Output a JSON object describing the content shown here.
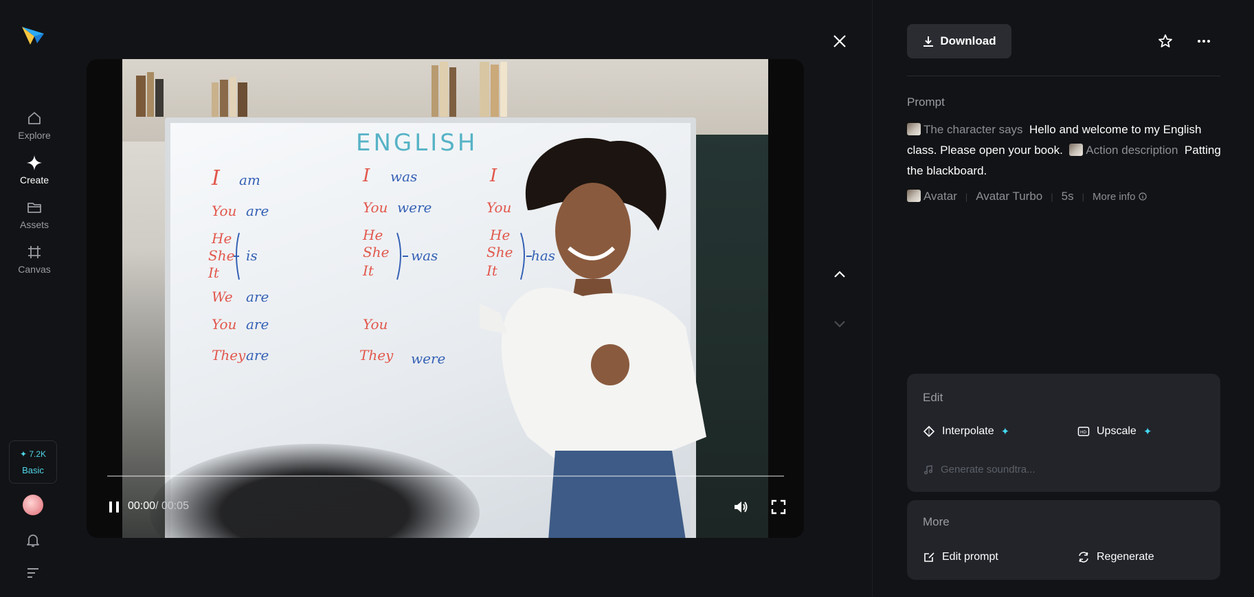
{
  "nav": {
    "items": [
      {
        "label": "Explore",
        "icon": "home-icon",
        "active": false
      },
      {
        "label": "Create",
        "icon": "sparkle-icon",
        "active": true
      },
      {
        "label": "Assets",
        "icon": "folder-icon",
        "active": false
      },
      {
        "label": "Canvas",
        "icon": "canvas-icon",
        "active": false
      }
    ],
    "credits": {
      "amount": "✦ 7.2K",
      "plan": "Basic"
    }
  },
  "player": {
    "current_time": "00:00",
    "total_time": "/ 00:05",
    "progress": 0,
    "board_title": "ENGLISH"
  },
  "toolbar": {
    "download_label": "Download"
  },
  "prompt": {
    "title": "Prompt",
    "chip_says": "The character says",
    "says_text": "Hello and welcome to my English class. Please open your book.",
    "chip_action": "Action description",
    "action_text": "Patting the blackboard."
  },
  "meta": {
    "type": "Avatar",
    "model": "Avatar Turbo",
    "duration": "5s",
    "more_info": "More info"
  },
  "edit": {
    "title": "Edit",
    "interpolate": "Interpolate",
    "upscale": "Upscale",
    "soundtrack": "Generate soundtra..."
  },
  "more": {
    "title": "More",
    "edit_prompt": "Edit prompt",
    "regenerate": "Regenerate"
  },
  "colors": {
    "accent": "#43d8f0",
    "background": "#121316",
    "panel": "#22242a"
  }
}
